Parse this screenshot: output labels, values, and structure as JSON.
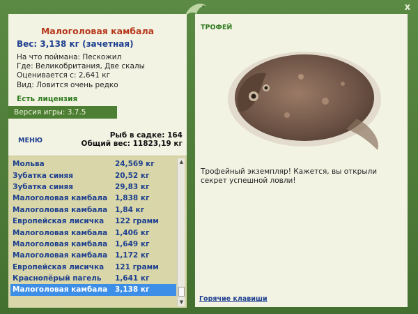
{
  "fish": {
    "title": "Малоголовая камбала",
    "weight": "Вес: 3,138 кг (зачетная)",
    "bait": "На что поймана: Пескожил",
    "where": "Где: Великобритания, Две скалы",
    "value": "Оценивается с: 2,641 кг",
    "kind": "Вид: Ловится очень редко"
  },
  "license": "Есть лицензия",
  "version": "Версия игры: 3.7.5",
  "menu_label": "МЕНЮ",
  "stats": {
    "count": "Рыб в садке: 164",
    "total": "Общий вес: 11823,19 кг"
  },
  "catch_list": [
    {
      "name": "Мольва",
      "weight": "24,569 кг"
    },
    {
      "name": "Зубатка синяя",
      "weight": "20,52 кг"
    },
    {
      "name": "Зубатка синяя",
      "weight": "29,83 кг"
    },
    {
      "name": "Малоголовая камбала",
      "weight": "1,838 кг"
    },
    {
      "name": "Малоголовая камбала",
      "weight": "1,84 кг"
    },
    {
      "name": "Европейская лисичка",
      "weight": "122 грамм"
    },
    {
      "name": "Малоголовая камбала",
      "weight": "1,406 кг"
    },
    {
      "name": "Малоголовая камбала",
      "weight": "1,649 кг"
    },
    {
      "name": "Малоголовая камбала",
      "weight": "1,172 кг"
    },
    {
      "name": "Европейская лисичка",
      "weight": "121 грамм"
    },
    {
      "name": "Краснопёрый пагель",
      "weight": "1,641 кг"
    },
    {
      "name": "Малоголовая камбала",
      "weight": "3,138 кг"
    }
  ],
  "selected_index": 11,
  "trophy_label": "ТРОФЕЙ",
  "trophy_text": "Трофейный экземпляр! Кажется, вы открыли секрет успешной ловли!",
  "hotkeys": "Горячие клавиши",
  "close_label": "x",
  "icons": {
    "logo": "fish-logo-icon",
    "close": "close-icon"
  }
}
